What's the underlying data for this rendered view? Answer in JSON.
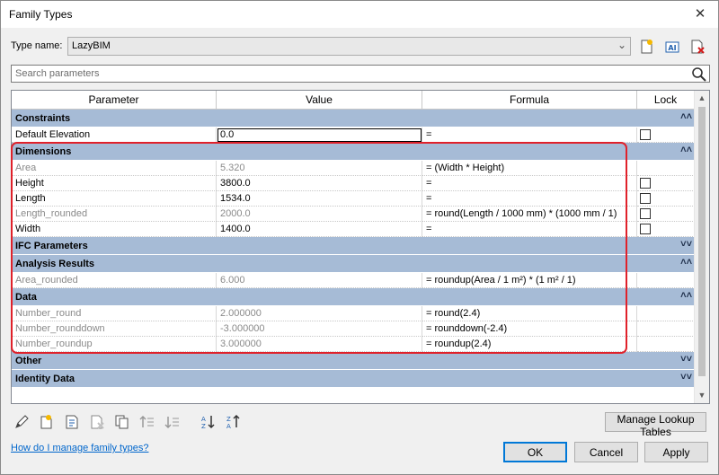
{
  "window": {
    "title": "Family Types",
    "close_glyph": "✕"
  },
  "type_name": {
    "label": "Type name:",
    "value": "LazyBIM"
  },
  "search": {
    "placeholder": "Search parameters"
  },
  "columns": {
    "parameter": "Parameter",
    "value": "Value",
    "formula": "Formula",
    "lock": "Lock"
  },
  "groups": {
    "constraints": {
      "name": "Constraints",
      "chevron": "˄˄"
    },
    "dimensions": {
      "name": "Dimensions",
      "chevron": "˄˄"
    },
    "ifc": {
      "name": "IFC Parameters",
      "chevron": "˅˅"
    },
    "analysis": {
      "name": "Analysis Results",
      "chevron": "˄˄"
    },
    "data": {
      "name": "Data",
      "chevron": "˄˄"
    },
    "other": {
      "name": "Other",
      "chevron": "˅˅"
    },
    "identity": {
      "name": "Identity Data",
      "chevron": "˅˅"
    }
  },
  "rows": {
    "default_elevation": {
      "param": "Default Elevation",
      "value": "0.0",
      "formula": "="
    },
    "area": {
      "param": "Area",
      "value": "5.320",
      "formula": "= (Width * Height)"
    },
    "height": {
      "param": "Height",
      "value": "3800.0",
      "formula": "="
    },
    "length": {
      "param": "Length",
      "value": "1534.0",
      "formula": "="
    },
    "length_rounded": {
      "param": "Length_rounded",
      "value": "2000.0",
      "formula": "= round(Length / 1000 mm) * (1000 mm / 1)"
    },
    "width": {
      "param": "Width",
      "value": "1400.0",
      "formula": "="
    },
    "area_rounded": {
      "param": "Area_rounded",
      "value": "6.000",
      "formula": "= roundup(Area / 1 m²) * (1 m² / 1)"
    },
    "number_round": {
      "param": "Number_round",
      "value": "2.000000",
      "formula": "= round(2.4)"
    },
    "number_rounddown": {
      "param": "Number_rounddown",
      "value": "-3.000000",
      "formula": "= rounddown(-2.4)"
    },
    "number_roundup": {
      "param": "Number_roundup",
      "value": "3.000000",
      "formula": "= roundup(2.4)"
    }
  },
  "buttons": {
    "manage_lookup": "Manage Lookup Tables",
    "ok": "OK",
    "cancel": "Cancel",
    "apply": "Apply"
  },
  "help_link": "How do I manage family types?",
  "colors": {
    "group_band": "#a6bbd6",
    "highlight": "#e0212a",
    "link": "#0066cc"
  }
}
